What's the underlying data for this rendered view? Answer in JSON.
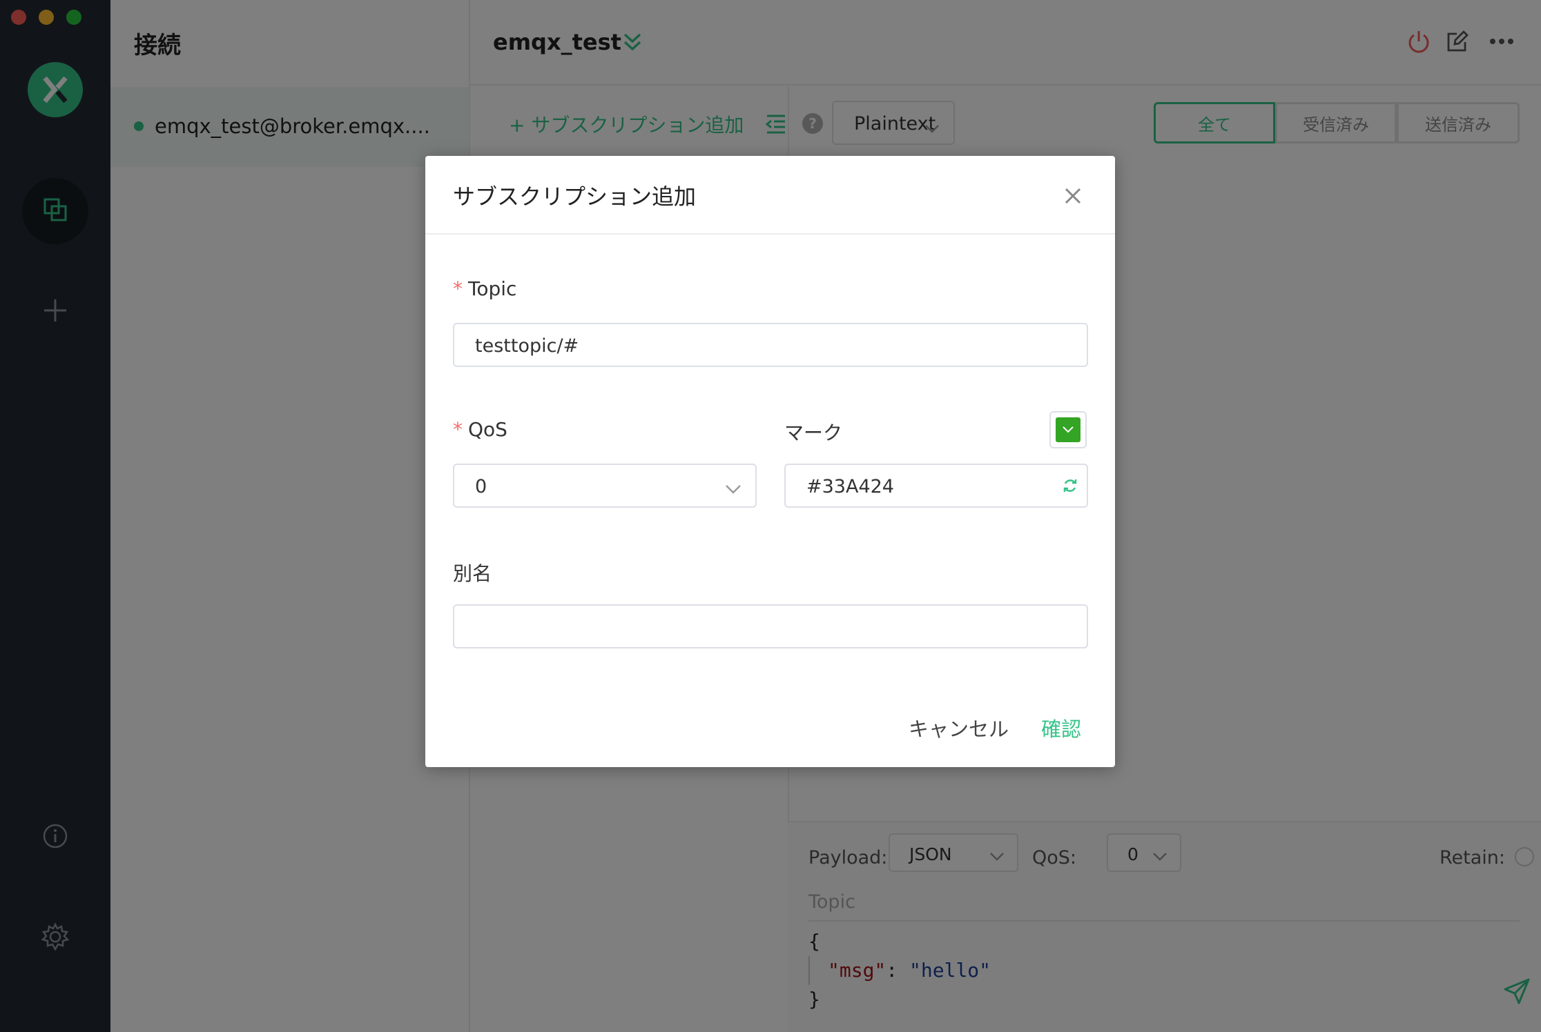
{
  "window": {
    "traffic_lights": [
      "close",
      "minimize",
      "zoom"
    ]
  },
  "nav": {
    "logo_icon": "mqttx-logo-icon",
    "items": [
      "connections-icon",
      "new-connection-icon",
      "about-icon",
      "settings-icon"
    ]
  },
  "connections": {
    "title": "接続",
    "items": [
      {
        "name": "emqx_test@broker.emqx....",
        "status_color": "#34c388"
      }
    ]
  },
  "header": {
    "title": "emqx_test",
    "icons": [
      "expand-chevron-icon",
      "disconnect-power-icon",
      "edit-icon",
      "more-icon"
    ]
  },
  "toolbar": {
    "add_subscription": "+ サブスクリプション追加",
    "help": "?",
    "payload_format": "Plaintext",
    "filters": [
      "全て",
      "受信済み",
      "送信済み"
    ]
  },
  "publish": {
    "payload_label": "Payload:",
    "payload_format": "JSON",
    "qos_label": "QoS:",
    "qos_value": "0",
    "retain_label": "Retain:",
    "topic_placeholder": "Topic",
    "code_open": "{",
    "code_key": "\"msg\"",
    "code_sep": ": ",
    "code_value": "\"hello\"",
    "code_close": "}"
  },
  "dialog": {
    "title": "サブスクリプション追加",
    "topic_label": "Topic",
    "topic_value": "testtopic/#",
    "qos_label": "QoS",
    "qos_value": "0",
    "mark_label": "マーク",
    "mark_color": "#33A424",
    "mark_value": "#33A424",
    "alias_label": "別名",
    "alias_value": "",
    "cancel": "キャンセル",
    "confirm": "確認",
    "required_mark": "*"
  },
  "colors": {
    "accent": "#34c388",
    "nav_bg": "#232a33",
    "required": "#f56c6c"
  }
}
